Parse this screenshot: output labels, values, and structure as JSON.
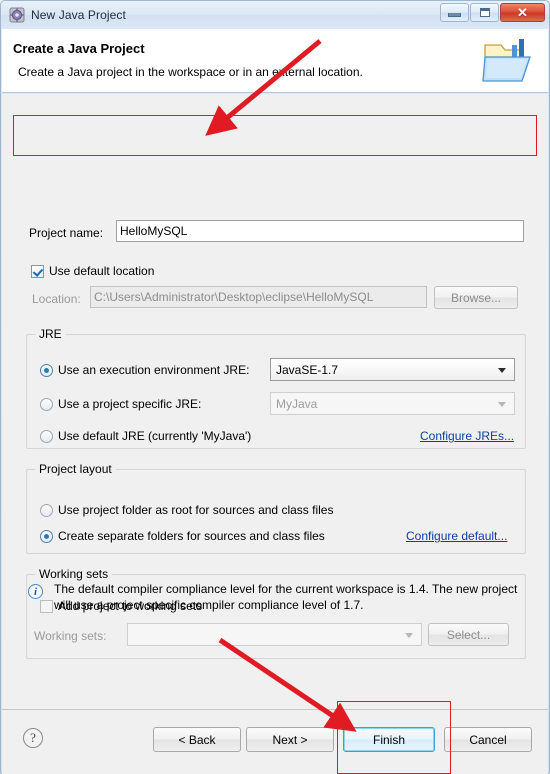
{
  "window": {
    "title": "New Java Project",
    "icon": "eclipse-wizard-icon",
    "controls": {
      "minimize": "minimize-icon",
      "maximize": "maximize-icon",
      "close": "close-icon",
      "close_glyph": "✕"
    }
  },
  "header": {
    "title": "Create a Java Project",
    "description": "Create a Java project in the workspace or in an external location.",
    "icon": "java-project-folder-icon"
  },
  "project_name": {
    "label": "Project name:",
    "value": "HelloMySQL",
    "placeholder": ""
  },
  "location": {
    "use_default_label": "Use default location",
    "use_default_checked": true,
    "label": "Location:",
    "value": "C:\\Users\\Administrator\\Desktop\\eclipse\\HelloMySQL",
    "browse_label": "Browse..."
  },
  "jre": {
    "group_title": "JRE",
    "options": [
      {
        "label": "Use an execution environment JRE:",
        "selected": true,
        "combo_value": "JavaSE-1.7",
        "combo_enabled": true
      },
      {
        "label": "Use a project specific JRE:",
        "selected": false,
        "combo_value": "MyJava",
        "combo_enabled": false
      },
      {
        "label": "Use default JRE (currently 'MyJava')",
        "selected": false
      }
    ],
    "configure_link": "Configure JREs..."
  },
  "project_layout": {
    "group_title": "Project layout",
    "options": [
      {
        "label": "Use project folder as root for sources and class files",
        "selected": false
      },
      {
        "label": "Create separate folders for sources and class files",
        "selected": true
      }
    ],
    "configure_link": "Configure default..."
  },
  "working_sets": {
    "group_title": "Working sets",
    "add_label": "Add project to working sets",
    "add_checked": false,
    "label": "Working sets:",
    "value": "",
    "select_label": "Select..."
  },
  "info": {
    "icon": "info-icon",
    "message": "The default compiler compliance level for the current workspace is 1.4. The new project will use a project specific compiler compliance level of 1.7."
  },
  "buttons": {
    "help": "?",
    "back": "< Back",
    "next": "Next >",
    "finish": "Finish",
    "cancel": "Cancel"
  },
  "annotations": {
    "color": "#e01b24",
    "highlight_project_name": "red-rectangle-project-name",
    "highlight_finish": "red-rectangle-finish",
    "arrow_to_project_name": "red-arrow-project-name",
    "arrow_to_finish": "red-arrow-finish"
  }
}
